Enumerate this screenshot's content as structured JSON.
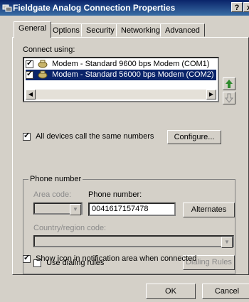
{
  "window": {
    "title": "Fieldgate Analog Connection Properties",
    "help_button": "?",
    "close_button": "x"
  },
  "tabs": [
    "General",
    "Options",
    "Security",
    "Networking",
    "Advanced"
  ],
  "active_tab": "General",
  "connect_using": {
    "label": "Connect using:",
    "modems": [
      {
        "label": "Modem - Standard  9600 bps Modem (COM1)",
        "checked": true,
        "selected": false
      },
      {
        "label": "Modem - Standard 56000 bps Modem (COM2)",
        "checked": true,
        "selected": true
      }
    ]
  },
  "all_devices": {
    "label": "All devices call the same numbers",
    "checked": true
  },
  "configure_button": "Configure...",
  "phone_number_group": {
    "title": "Phone number",
    "area_code_label": "Area code:",
    "area_code_value": "",
    "phone_label": "Phone number:",
    "phone_value": "0041617157478",
    "alternates_button": "Alternates",
    "country_label": "Country/region code:",
    "country_value": "",
    "use_dialing_rules": {
      "label": "Use dialing rules",
      "checked": false
    },
    "dialing_rules_button": "Dialing Rules"
  },
  "show_icon": {
    "label": "Show icon in notification area when connected",
    "checked": true
  },
  "ok_button": "OK",
  "cancel_button": "Cancel",
  "colors": {
    "title_bar": "#0a246a",
    "dialog": "#d4d0c8",
    "selection": "#0a246a",
    "move_up_arrow": "#2e8b2e"
  }
}
